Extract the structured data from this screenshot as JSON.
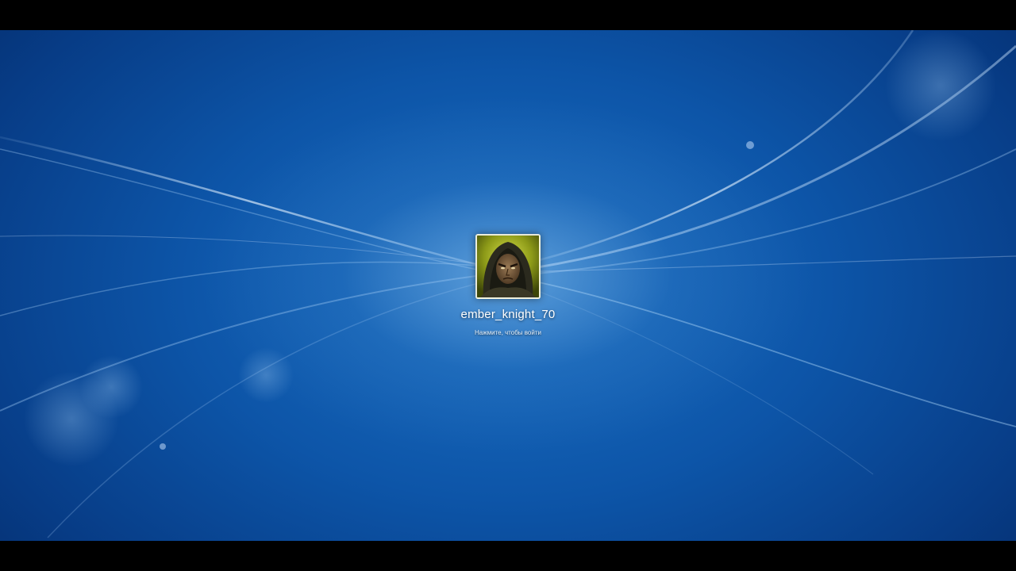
{
  "login": {
    "username": "ember_knight_70",
    "hint": "Нажмите, чтобы войти",
    "avatar_icon": "hooded-warrior-avatar-icon"
  },
  "colors": {
    "background_dark": "#052e6e",
    "background_mid": "#0d55a8",
    "background_light": "#1a6ec2",
    "avatar_accent": "#b7c234",
    "text": "#ffffff"
  }
}
